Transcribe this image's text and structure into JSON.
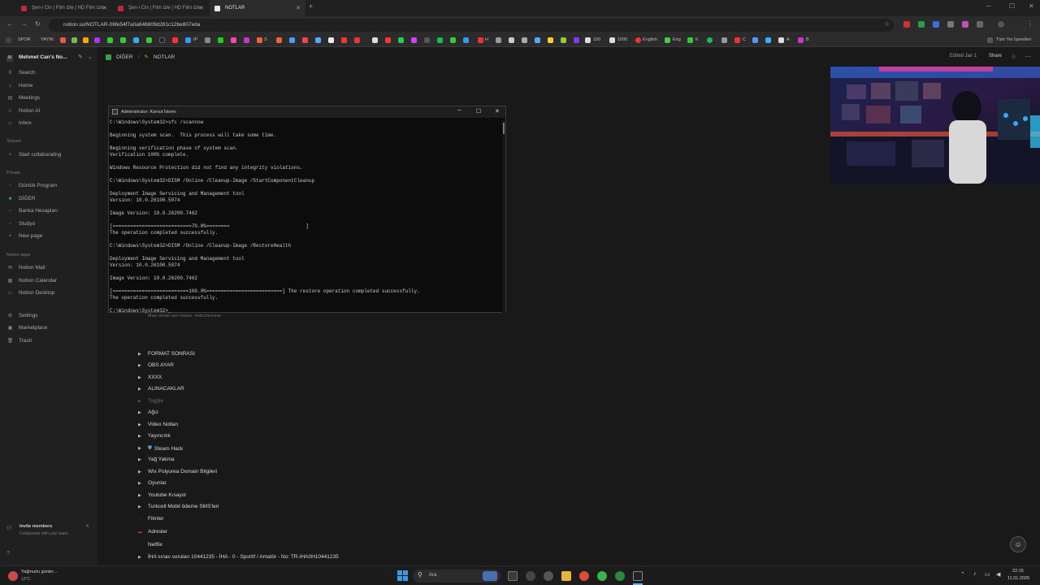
{
  "browser": {
    "tabs": [
      {
        "title": "Şen-i Cin | Film izle | HD Film izle"
      },
      {
        "title": "Şen-i Cin | Film izle | HD Film izle"
      },
      {
        "title": "NOTLAR"
      }
    ],
    "new_tab": "+",
    "url": "notion.so/NOTLAR-06fe54f7a0a646809d281c12be807eda",
    "bookmarks_left": [
      "SPOR",
      "YAYIN"
    ],
    "bookmarks_mid": [
      "IP",
      "S",
      "H",
      "100",
      "1000",
      "English",
      "Eng",
      "K",
      "C",
      "A",
      "B"
    ],
    "bookmarks_right": "Tüm Yer İşaretleri"
  },
  "sidebar": {
    "workspace": "Mehmet Can's No...",
    "top": [
      {
        "label": "Search",
        "icon": "search-icon"
      },
      {
        "label": "Home",
        "icon": "home-icon"
      },
      {
        "label": "Meetings",
        "icon": "meetings-icon"
      },
      {
        "label": "Notion AI",
        "icon": "ai-icon"
      },
      {
        "label": "Inbox",
        "icon": "inbox-icon"
      }
    ],
    "shared_header": "Shared",
    "shared": [
      {
        "label": "Start collaborating"
      }
    ],
    "private_header": "Private",
    "private": [
      {
        "label": "Günlük Program"
      },
      {
        "label": "DİĞER"
      },
      {
        "label": "Banka Hesapları"
      },
      {
        "label": "Studyo"
      },
      {
        "label": "New page"
      }
    ],
    "apps_header": "Notion apps",
    "apps": [
      {
        "label": "Notion Mail"
      },
      {
        "label": "Notion Calendar"
      },
      {
        "label": "Notion Desktop"
      }
    ],
    "bottom": [
      {
        "label": "Settings"
      },
      {
        "label": "Marketplace"
      },
      {
        "label": "Trash"
      }
    ],
    "invite_title": "Invite members",
    "invite_sub": "Collaborate with your team."
  },
  "page": {
    "breadcrumb": [
      "DİĞER",
      "NOTLAR"
    ],
    "edited": "Edited Jan 1",
    "share": "Share",
    "note_line": "Mavi ekran ram hatası: mdsched.exe",
    "toggles": [
      {
        "label": "FORMAT SONRASI"
      },
      {
        "label": "OBS AYAR"
      },
      {
        "label": "XXXX"
      },
      {
        "label": "ALINACAKLAR"
      },
      {
        "label": "Toggle"
      },
      {
        "label": "Ağız"
      },
      {
        "label": "Video Notları"
      },
      {
        "label": "Yayıncılık"
      },
      {
        "label": "Steam Hack"
      },
      {
        "label": "Yağ Yakma"
      },
      {
        "label": "Wix Polyurea Domain Bilgileri"
      },
      {
        "label": "Oyunlar"
      },
      {
        "label": "Youtube Kısayol"
      },
      {
        "label": "Turkcell Mobil ödeme SMS'leri"
      },
      {
        "label": "Filmler"
      },
      {
        "label": "Adresler"
      },
      {
        "label": "Netflix"
      },
      {
        "label": "İHA sınav soruları 10441235 - İHA - 0 - Sportif / Amatör - No: TR-IHA0H10441235"
      }
    ]
  },
  "cmd": {
    "title": "Administrator: Komut İstemi",
    "lines": [
      "C:\\Windows\\System32>sfc /scannow",
      "",
      "Beginning system scan.  This process will take some time.",
      "",
      "Beginning verification phase of system scan.",
      "Verification 100% complete.",
      "",
      "Windows Resource Protection did not find any integrity violations.",
      "",
      "C:\\Windows\\System32>DISM /Online /Cleanup-Image /StartComponentCleanup",
      "",
      "Deployment Image Servicing and Management tool",
      "Version: 10.0.26100.5074",
      "",
      "Image Version: 10.0.26200.7462",
      "",
      "[===========================70.0%========                          ]",
      "The operation completed successfully.",
      "",
      "C:\\Windows\\System32>DISM /Online /Cleanup-Image /RestoreHealth",
      "",
      "Deployment Image Servicing and Management tool",
      "Version: 10.0.26100.5074",
      "",
      "Image Version: 10.0.26200.7462",
      "",
      "[==========================100.0%==========================] The restore operation completed successfully.",
      "The operation completed successfully.",
      "",
      "C:\\Windows\\System32>_"
    ]
  },
  "taskbar": {
    "weather": "Yağmurlu günler...",
    "temp": "12°C",
    "search": "Ara",
    "time": "22:15",
    "date": "11.01.2026"
  },
  "colors": {
    "background": "#191919",
    "sidebar": "#202020",
    "cmd_bg": "#0c0c0c",
    "accent_green": "#22a35a"
  }
}
